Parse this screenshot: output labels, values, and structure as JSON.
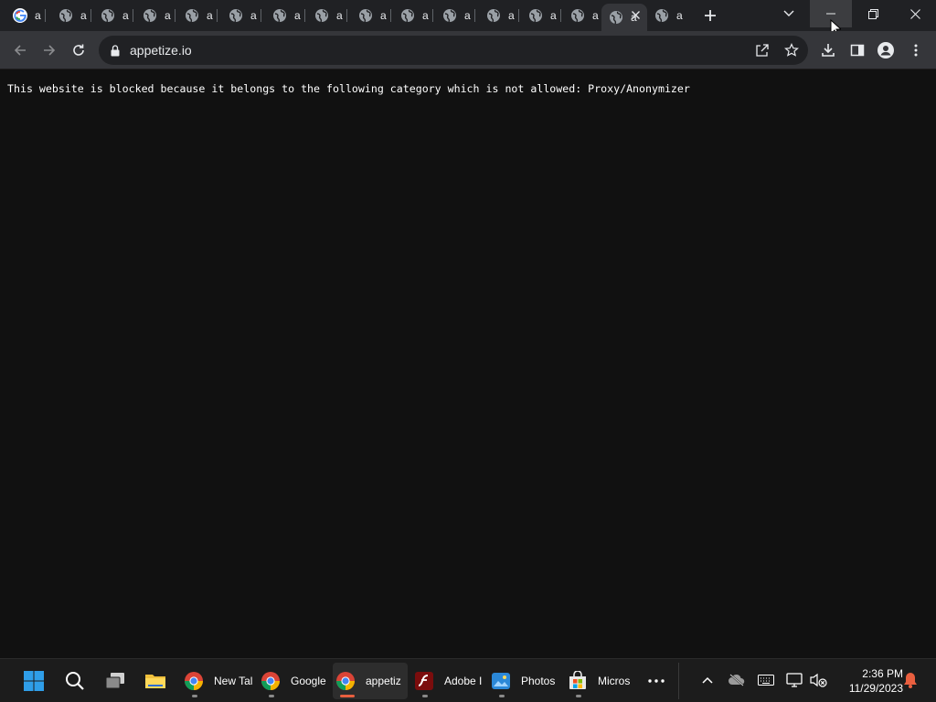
{
  "browser": {
    "tabs": [
      {
        "label": "a",
        "favicon": "google-g-icon"
      },
      {
        "label": "a",
        "favicon": "globe-icon"
      },
      {
        "label": "a",
        "favicon": "globe-icon"
      },
      {
        "label": "a",
        "favicon": "globe-icon"
      },
      {
        "label": "a",
        "favicon": "globe-icon"
      },
      {
        "label": "a",
        "favicon": "globe-icon"
      },
      {
        "label": "a",
        "favicon": "globe-icon"
      },
      {
        "label": "a",
        "favicon": "globe-icon"
      },
      {
        "label": "a",
        "favicon": "globe-icon"
      },
      {
        "label": "a",
        "favicon": "globe-icon"
      },
      {
        "label": "a",
        "favicon": "globe-icon"
      },
      {
        "label": "a",
        "favicon": "globe-icon"
      },
      {
        "label": "a",
        "favicon": "globe-icon"
      },
      {
        "label": "a",
        "favicon": "globe-icon"
      },
      {
        "label": "a",
        "favicon": "globe-icon",
        "active": true
      },
      {
        "label": "a",
        "favicon": "globe-icon"
      }
    ],
    "address_bar": {
      "url": "appetize.io"
    },
    "colors": {
      "tabstrip": "#202124",
      "toolbar": "#35363a",
      "omnibox": "#202124",
      "page_bg": "#111111"
    }
  },
  "page": {
    "message": "This website is blocked because it belongs to the following category which is not allowed: Proxy/Anonymizer"
  },
  "taskbar": {
    "apps": [
      {
        "label": "New Tal",
        "icon": "chrome-icon"
      },
      {
        "label": "Google",
        "icon": "chrome-icon"
      },
      {
        "label": "appetiz",
        "icon": "chrome-icon",
        "active": true
      },
      {
        "label": "Adobe I",
        "icon": "adobe-flash-icon"
      },
      {
        "label": "Photos",
        "icon": "photos-icon"
      },
      {
        "label": "Micros",
        "icon": "microsoft-store-icon"
      }
    ],
    "clock": {
      "time": "2:36 PM",
      "date": "11/29/2023"
    }
  }
}
